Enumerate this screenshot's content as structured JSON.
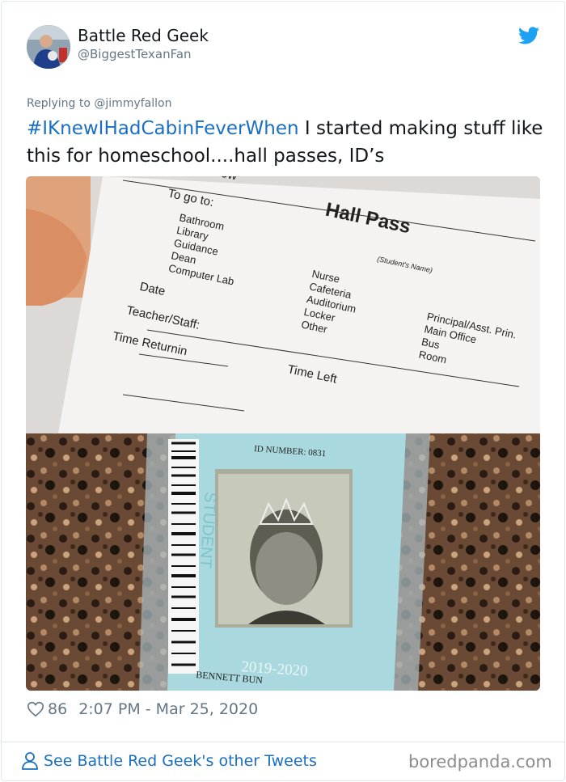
{
  "author": {
    "name": "Battle Red Geek",
    "handle": "@BiggestTexanFan"
  },
  "tweet": {
    "replying_to": "Replying to @jimmyfallon",
    "hashtag": "#IKnewIHadCabinFeverWhen",
    "text": " I started making stuff like this for homeschool....hall passes, ID’s",
    "likes": "86",
    "timestamp": "2:07 PM - Mar 25, 2020"
  },
  "media": {
    "hall_pass": {
      "allow": "lease allow",
      "title": "Hall Pass",
      "student_name": "(Student's Name)",
      "go_to": "To go to:",
      "options_col1": [
        "Bathroom",
        "Library",
        "Guidance",
        "Dean",
        "Computer Lab"
      ],
      "options_col2": [
        "Nurse",
        "Cafeteria",
        "Auditorium",
        "Locker",
        "Other"
      ],
      "options_col3": [
        "Principal/Asst. Prin.",
        "Main Office",
        "Bus",
        "Room"
      ],
      "date": "Date",
      "teacher": "Teacher/Staff:",
      "time_left": "Time Left",
      "time_returning": "Time Returnin"
    },
    "id_card": {
      "id_number": "ID NUMBER: 0831",
      "side_label": "STUDENT",
      "year": "2019-2020",
      "name": "BENNETT BUN"
    }
  },
  "footer": {
    "link_text": "See Battle Red Geek's other Tweets",
    "watermark": "boredpanda.com"
  },
  "colors": {
    "link_blue": "#1b6fc2",
    "twitter_blue": "#1da1f2",
    "muted_gray": "#657786"
  },
  "icons": [
    "twitter-bird-icon",
    "heart-icon",
    "person-icon"
  ]
}
